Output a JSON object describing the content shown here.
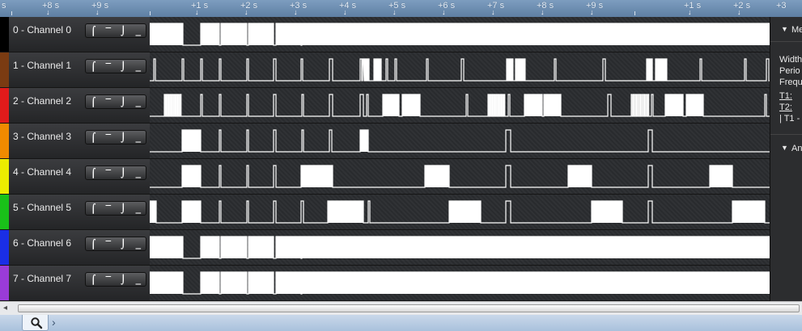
{
  "ruler": {
    "ticks": [
      {
        "label": "+8 s"
      },
      {
        "label": "+9 s"
      },
      {
        "label": "+1 s"
      },
      {
        "label": "+2 s"
      },
      {
        "label": "+3 s"
      },
      {
        "label": "+4 s"
      },
      {
        "label": "+5 s"
      },
      {
        "label": "+6 s"
      },
      {
        "label": "+7 s"
      },
      {
        "label": "+8 s"
      },
      {
        "label": "+9 s"
      },
      {
        "label": "+1 s"
      },
      {
        "label": "+2 s"
      },
      {
        "label": "+3"
      }
    ],
    "edge_label": "s"
  },
  "channels": [
    {
      "label": "0 - Channel 0",
      "color": "#000000",
      "trace": "ch0"
    },
    {
      "label": "1 - Channel 1",
      "color": "#7a3b12",
      "trace": "ch1"
    },
    {
      "label": "2 - Channel 2",
      "color": "#e11b1b",
      "trace": "ch2"
    },
    {
      "label": "3 - Channel 3",
      "color": "#f08a00",
      "trace": "ch3"
    },
    {
      "label": "4 - Channel 4",
      "color": "#ecec00",
      "trace": "ch4"
    },
    {
      "label": "5 - Channel 5",
      "color": "#19c119",
      "trace": "ch5"
    },
    {
      "label": "6 - Channel 6",
      "color": "#1a2ee6",
      "trace": "ch6"
    },
    {
      "label": "7 - Channel 7",
      "color": "#9a3bd8",
      "trace": "ch7"
    }
  ],
  "trigger_buttons": {
    "rising": "⌠",
    "high": "‾",
    "falling": "⌡",
    "low": "_"
  },
  "side_panel": {
    "measurements_header": "Me",
    "measure_lines": [
      "Width",
      "Perio",
      "Frequ",
      "T1:",
      "T2:",
      "| T1 -"
    ],
    "analyzers_header": "An",
    "collapse_glyph": "▼"
  },
  "bottom": {
    "scroll_left_arrow": "◂",
    "nav_chevron": "›"
  },
  "icons": {
    "search": "search-icon",
    "tab_chevron": "chevron-right-icon"
  }
}
